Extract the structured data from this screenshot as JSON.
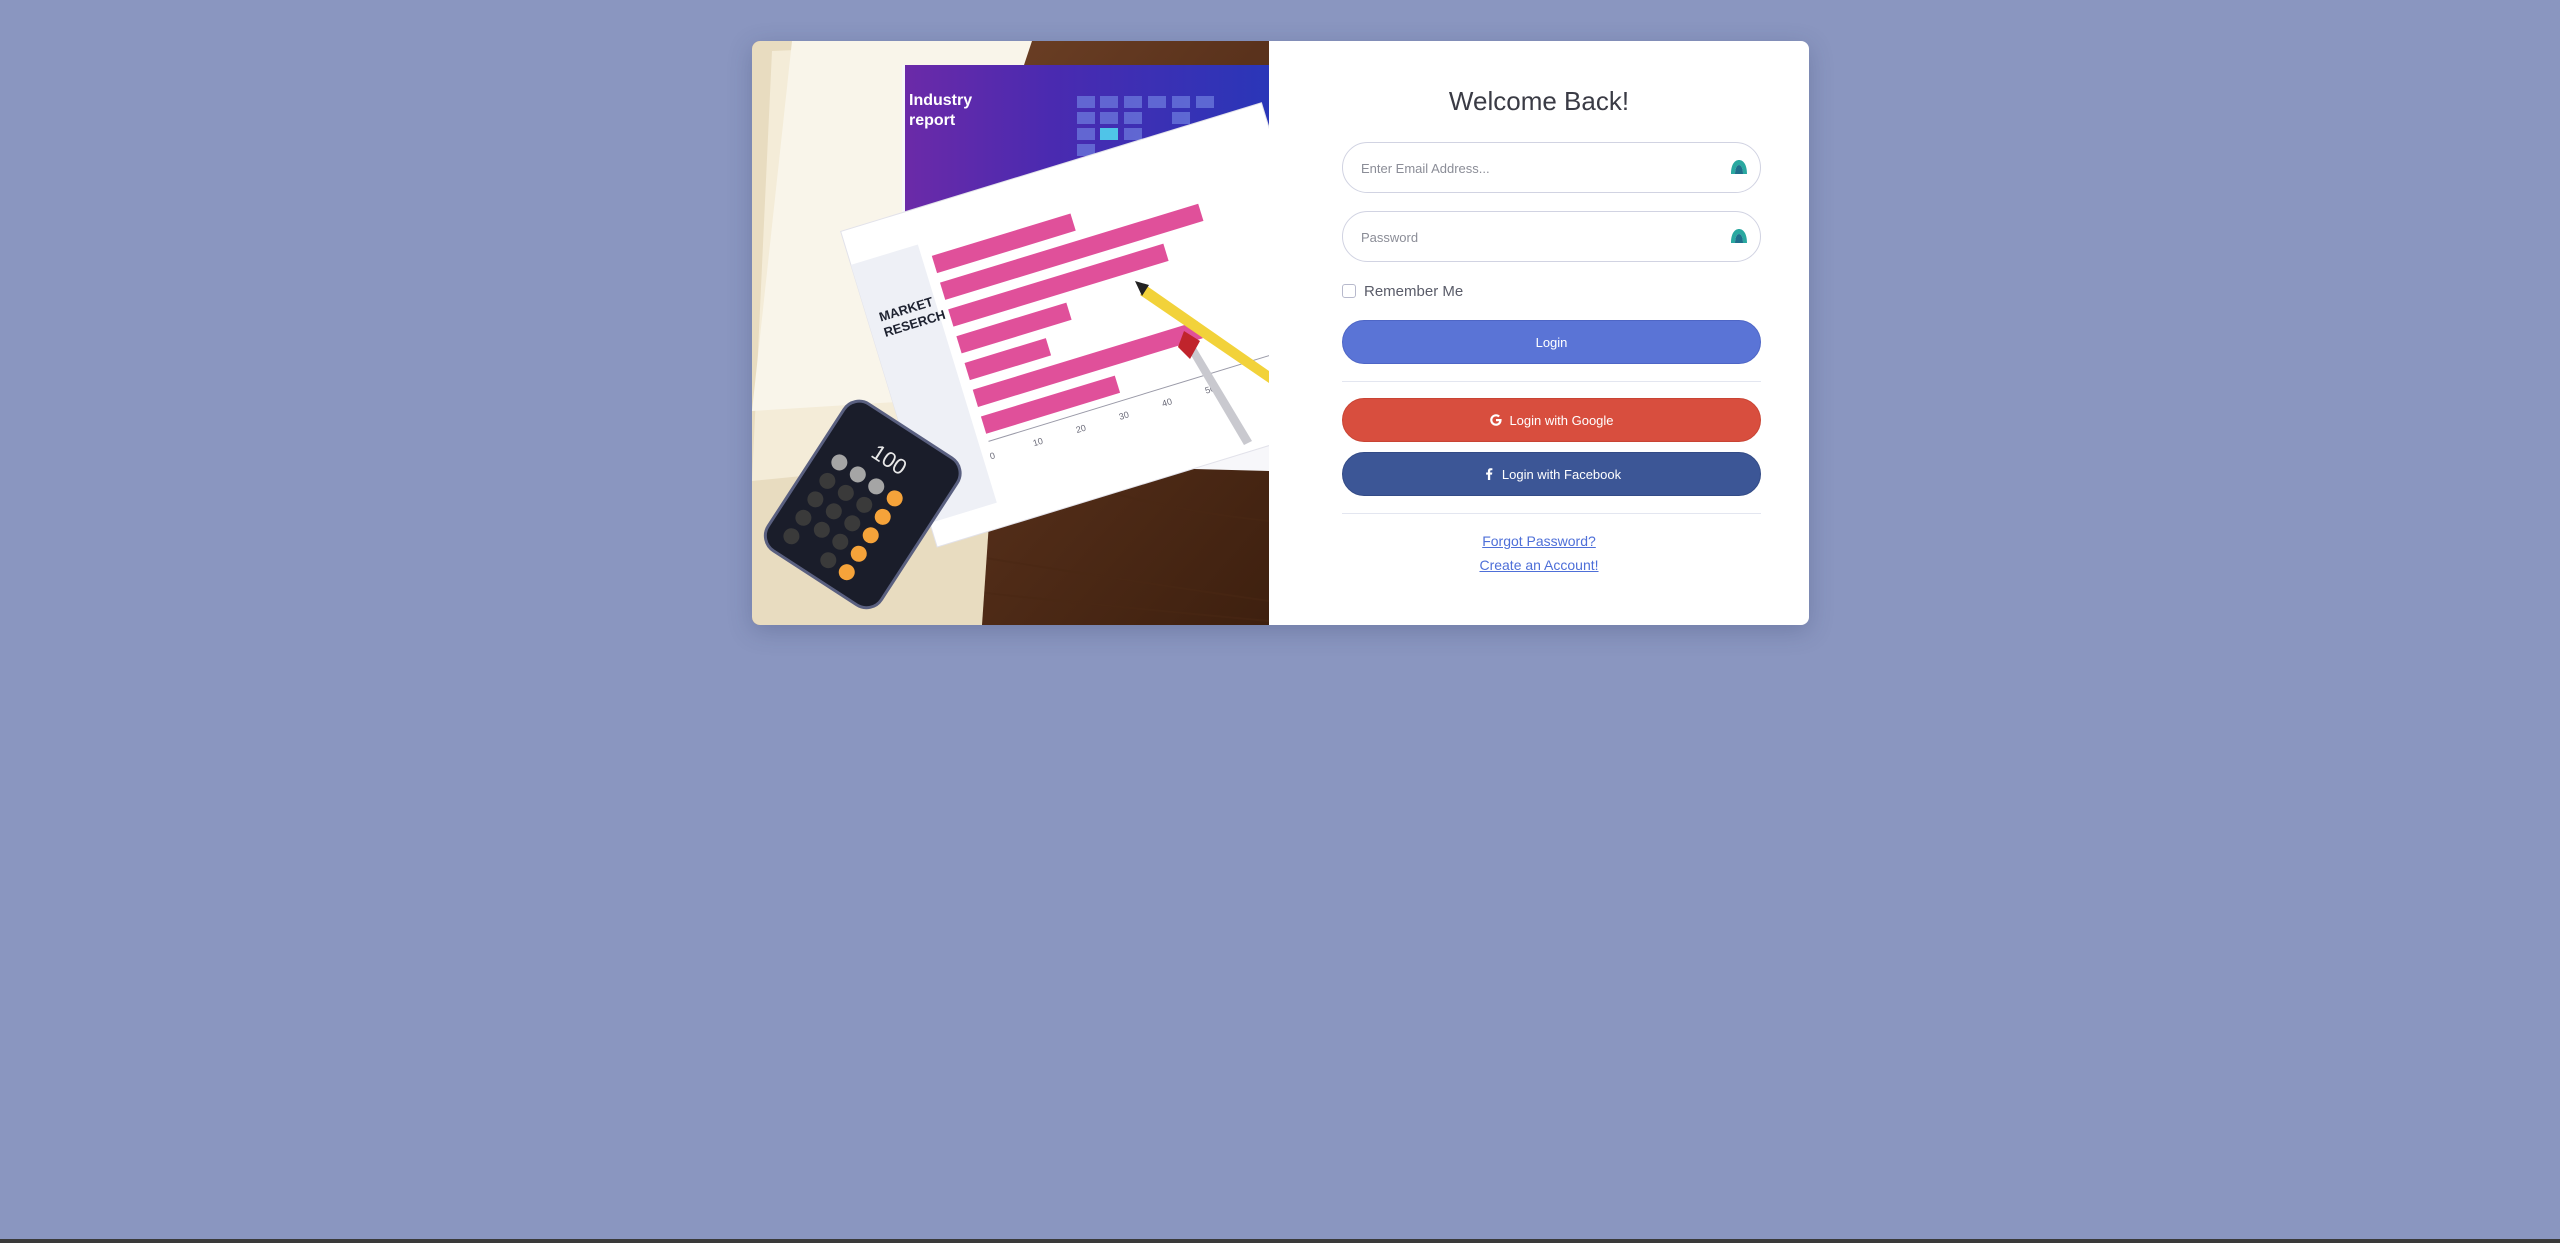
{
  "login": {
    "title": "Welcome Back!",
    "email_placeholder": "Enter Email Address...",
    "password_placeholder": "Password",
    "remember_label": "Remember Me",
    "login_button": "Login",
    "google_button": "Login with Google",
    "facebook_button": "Login with Facebook",
    "forgot_link": "Forgot Password?",
    "create_link": "Create an Account!"
  },
  "photo": {
    "report_title_line1": "Industry",
    "report_title_line2": "report",
    "tab_line1": "MARKET",
    "tab_line2": "RESERCH",
    "axis_ticks": [
      "0",
      "10",
      "20",
      "30",
      "40",
      "50"
    ],
    "calculator_display": "100"
  },
  "colors": {
    "background": "#8a96c0",
    "login": "#5a74d6",
    "google": "#d84e3e",
    "facebook": "#3c5696",
    "link": "#4e6fd8"
  },
  "icons": {
    "email_field": "password-manager-icon",
    "password_field": "password-manager-icon",
    "google": "google-icon",
    "facebook": "facebook-icon"
  }
}
